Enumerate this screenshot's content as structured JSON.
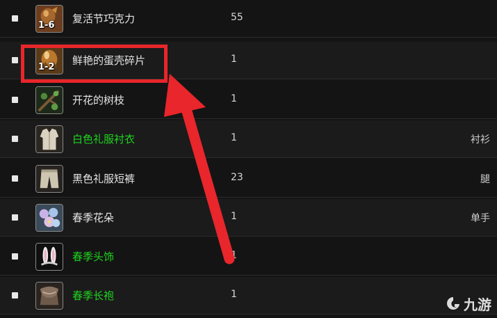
{
  "items": [
    {
      "name": "复活节巧克力",
      "qty": "55",
      "slot": "",
      "badge": "1-6",
      "color": "white",
      "icon": "chocolate-icon"
    },
    {
      "name": "鲜艳的蛋壳碎片",
      "qty": "1",
      "slot": "",
      "badge": "1-2",
      "color": "white",
      "icon": "eggshell-icon"
    },
    {
      "name": "开花的树枝",
      "qty": "1",
      "slot": "",
      "badge": "",
      "color": "white",
      "icon": "branch-icon"
    },
    {
      "name": "白色礼服衬衣",
      "qty": "1",
      "slot": "衬衫",
      "badge": "",
      "color": "green",
      "icon": "shirt-icon"
    },
    {
      "name": "黑色礼服短裤",
      "qty": "23",
      "slot": "腿",
      "badge": "",
      "color": "white",
      "icon": "shorts-icon"
    },
    {
      "name": "春季花朵",
      "qty": "1",
      "slot": "单手",
      "badge": "",
      "color": "white",
      "icon": "flower-icon"
    },
    {
      "name": "春季头饰",
      "qty": "1",
      "slot": "",
      "badge": "",
      "color": "green",
      "icon": "bunny-ears-icon"
    },
    {
      "name": "春季长袍",
      "qty": "1",
      "slot": "",
      "badge": "",
      "color": "green",
      "icon": "robe-icon"
    }
  ],
  "annotation": {
    "color": "#e8262b"
  },
  "watermark": {
    "text": "九游"
  }
}
